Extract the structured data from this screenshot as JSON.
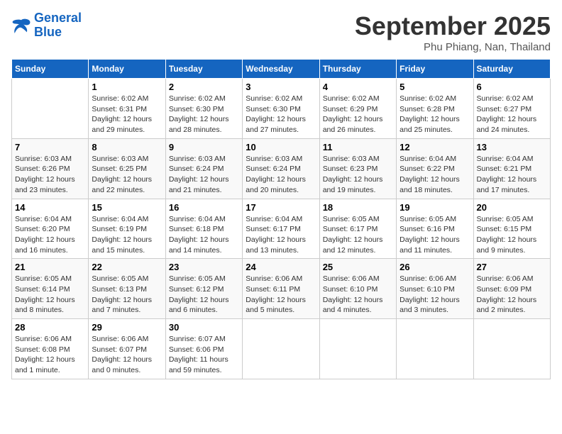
{
  "header": {
    "logo_line1": "General",
    "logo_line2": "Blue",
    "month": "September 2025",
    "location": "Phu Phiang, Nan, Thailand"
  },
  "days_of_week": [
    "Sunday",
    "Monday",
    "Tuesday",
    "Wednesday",
    "Thursday",
    "Friday",
    "Saturday"
  ],
  "weeks": [
    [
      {
        "day": "",
        "info": ""
      },
      {
        "day": "1",
        "info": "Sunrise: 6:02 AM\nSunset: 6:31 PM\nDaylight: 12 hours\nand 29 minutes."
      },
      {
        "day": "2",
        "info": "Sunrise: 6:02 AM\nSunset: 6:30 PM\nDaylight: 12 hours\nand 28 minutes."
      },
      {
        "day": "3",
        "info": "Sunrise: 6:02 AM\nSunset: 6:30 PM\nDaylight: 12 hours\nand 27 minutes."
      },
      {
        "day": "4",
        "info": "Sunrise: 6:02 AM\nSunset: 6:29 PM\nDaylight: 12 hours\nand 26 minutes."
      },
      {
        "day": "5",
        "info": "Sunrise: 6:02 AM\nSunset: 6:28 PM\nDaylight: 12 hours\nand 25 minutes."
      },
      {
        "day": "6",
        "info": "Sunrise: 6:02 AM\nSunset: 6:27 PM\nDaylight: 12 hours\nand 24 minutes."
      }
    ],
    [
      {
        "day": "7",
        "info": "Sunrise: 6:03 AM\nSunset: 6:26 PM\nDaylight: 12 hours\nand 23 minutes."
      },
      {
        "day": "8",
        "info": "Sunrise: 6:03 AM\nSunset: 6:25 PM\nDaylight: 12 hours\nand 22 minutes."
      },
      {
        "day": "9",
        "info": "Sunrise: 6:03 AM\nSunset: 6:24 PM\nDaylight: 12 hours\nand 21 minutes."
      },
      {
        "day": "10",
        "info": "Sunrise: 6:03 AM\nSunset: 6:24 PM\nDaylight: 12 hours\nand 20 minutes."
      },
      {
        "day": "11",
        "info": "Sunrise: 6:03 AM\nSunset: 6:23 PM\nDaylight: 12 hours\nand 19 minutes."
      },
      {
        "day": "12",
        "info": "Sunrise: 6:04 AM\nSunset: 6:22 PM\nDaylight: 12 hours\nand 18 minutes."
      },
      {
        "day": "13",
        "info": "Sunrise: 6:04 AM\nSunset: 6:21 PM\nDaylight: 12 hours\nand 17 minutes."
      }
    ],
    [
      {
        "day": "14",
        "info": "Sunrise: 6:04 AM\nSunset: 6:20 PM\nDaylight: 12 hours\nand 16 minutes."
      },
      {
        "day": "15",
        "info": "Sunrise: 6:04 AM\nSunset: 6:19 PM\nDaylight: 12 hours\nand 15 minutes."
      },
      {
        "day": "16",
        "info": "Sunrise: 6:04 AM\nSunset: 6:18 PM\nDaylight: 12 hours\nand 14 minutes."
      },
      {
        "day": "17",
        "info": "Sunrise: 6:04 AM\nSunset: 6:17 PM\nDaylight: 12 hours\nand 13 minutes."
      },
      {
        "day": "18",
        "info": "Sunrise: 6:05 AM\nSunset: 6:17 PM\nDaylight: 12 hours\nand 12 minutes."
      },
      {
        "day": "19",
        "info": "Sunrise: 6:05 AM\nSunset: 6:16 PM\nDaylight: 12 hours\nand 11 minutes."
      },
      {
        "day": "20",
        "info": "Sunrise: 6:05 AM\nSunset: 6:15 PM\nDaylight: 12 hours\nand 9 minutes."
      }
    ],
    [
      {
        "day": "21",
        "info": "Sunrise: 6:05 AM\nSunset: 6:14 PM\nDaylight: 12 hours\nand 8 minutes."
      },
      {
        "day": "22",
        "info": "Sunrise: 6:05 AM\nSunset: 6:13 PM\nDaylight: 12 hours\nand 7 minutes."
      },
      {
        "day": "23",
        "info": "Sunrise: 6:05 AM\nSunset: 6:12 PM\nDaylight: 12 hours\nand 6 minutes."
      },
      {
        "day": "24",
        "info": "Sunrise: 6:06 AM\nSunset: 6:11 PM\nDaylight: 12 hours\nand 5 minutes."
      },
      {
        "day": "25",
        "info": "Sunrise: 6:06 AM\nSunset: 6:10 PM\nDaylight: 12 hours\nand 4 minutes."
      },
      {
        "day": "26",
        "info": "Sunrise: 6:06 AM\nSunset: 6:10 PM\nDaylight: 12 hours\nand 3 minutes."
      },
      {
        "day": "27",
        "info": "Sunrise: 6:06 AM\nSunset: 6:09 PM\nDaylight: 12 hours\nand 2 minutes."
      }
    ],
    [
      {
        "day": "28",
        "info": "Sunrise: 6:06 AM\nSunset: 6:08 PM\nDaylight: 12 hours\nand 1 minute."
      },
      {
        "day": "29",
        "info": "Sunrise: 6:06 AM\nSunset: 6:07 PM\nDaylight: 12 hours\nand 0 minutes."
      },
      {
        "day": "30",
        "info": "Sunrise: 6:07 AM\nSunset: 6:06 PM\nDaylight: 11 hours\nand 59 minutes."
      },
      {
        "day": "",
        "info": ""
      },
      {
        "day": "",
        "info": ""
      },
      {
        "day": "",
        "info": ""
      },
      {
        "day": "",
        "info": ""
      }
    ]
  ]
}
